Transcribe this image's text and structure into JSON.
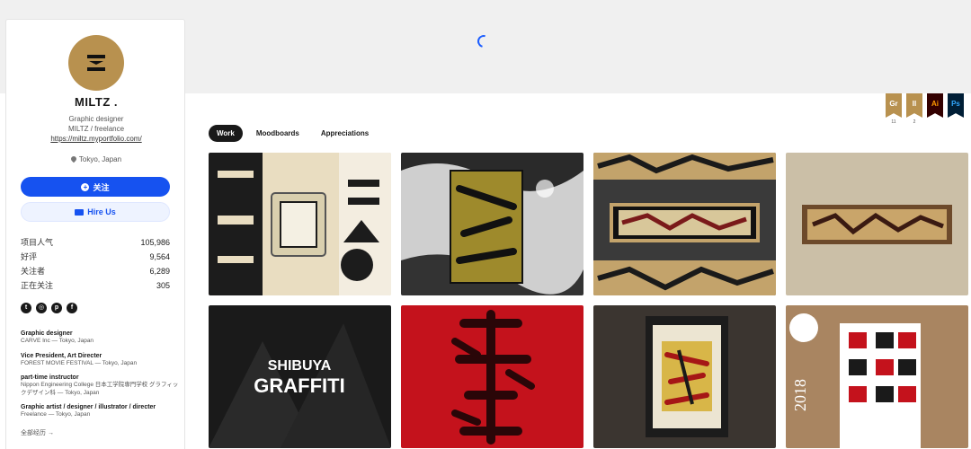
{
  "profile": {
    "avatar_icon": "miltz-logo-icon",
    "name": "MILTZ .",
    "occupation": "Graphic designer",
    "company": "MILTZ / freelance",
    "website": "https://miltz.myportfolio.com/",
    "location": "Tokyo, Japan",
    "follow_label": "关注",
    "hire_label": "Hire Us",
    "stats": [
      {
        "label": "项目人气",
        "value": "105,986"
      },
      {
        "label": "好评",
        "value": "9,564"
      },
      {
        "label": "关注者",
        "value": "6,289"
      },
      {
        "label": "正在关注",
        "value": "305"
      }
    ],
    "social_icons": [
      "twitter-icon",
      "instagram-icon",
      "pinterest-icon",
      "facebook-icon"
    ],
    "work_experience": [
      {
        "title": "Graphic designer",
        "detail": "CARVE Inc — Tokyo, Japan"
      },
      {
        "title": "Vice President, Art Directer",
        "detail": "FOREST MOVIE FESTIVAL — Tokyo, Japan"
      },
      {
        "title": "part-time instructor",
        "detail": "Nippon Engineering College 日本工学院専門学校 グラフィックデザイン科 — Tokyo, Japan"
      },
      {
        "title": "Graphic artist / designer / illustrator / directer",
        "detail": "Freelance — Tokyo, Japan"
      }
    ],
    "more_label": "全部经历 →"
  },
  "tools": [
    {
      "abbr": "Gr",
      "count": "11",
      "bg": "#b8914f",
      "fg": "#ffffff"
    },
    {
      "abbr": "Il",
      "count": "2",
      "bg": "#b8914f",
      "fg": "#ffffff"
    },
    {
      "abbr": "Ai",
      "count": "",
      "bg": "#330000",
      "fg": "#ff9a00"
    },
    {
      "abbr": "Ps",
      "count": "",
      "bg": "#001e36",
      "fg": "#31a8ff"
    }
  ],
  "tabs": [
    {
      "label": "Work",
      "active": true
    },
    {
      "label": "Moodboards",
      "active": false
    },
    {
      "label": "Appreciations",
      "active": false
    }
  ],
  "projects": [
    {
      "name": "project-tofu-packaging"
    },
    {
      "name": "project-graffiti-poster"
    },
    {
      "name": "project-kanji-framed-banner"
    },
    {
      "name": "project-framed-wall-art"
    },
    {
      "name": "project-shibuya-graffiti",
      "text": "SHIBUYA GRAFFITI"
    },
    {
      "name": "project-red-calligraphy"
    },
    {
      "name": "project-framed-print"
    },
    {
      "name": "project-new-year-2018",
      "text": "2018"
    }
  ],
  "colors": {
    "accent": "#1652f0",
    "gold": "#b8914f"
  }
}
